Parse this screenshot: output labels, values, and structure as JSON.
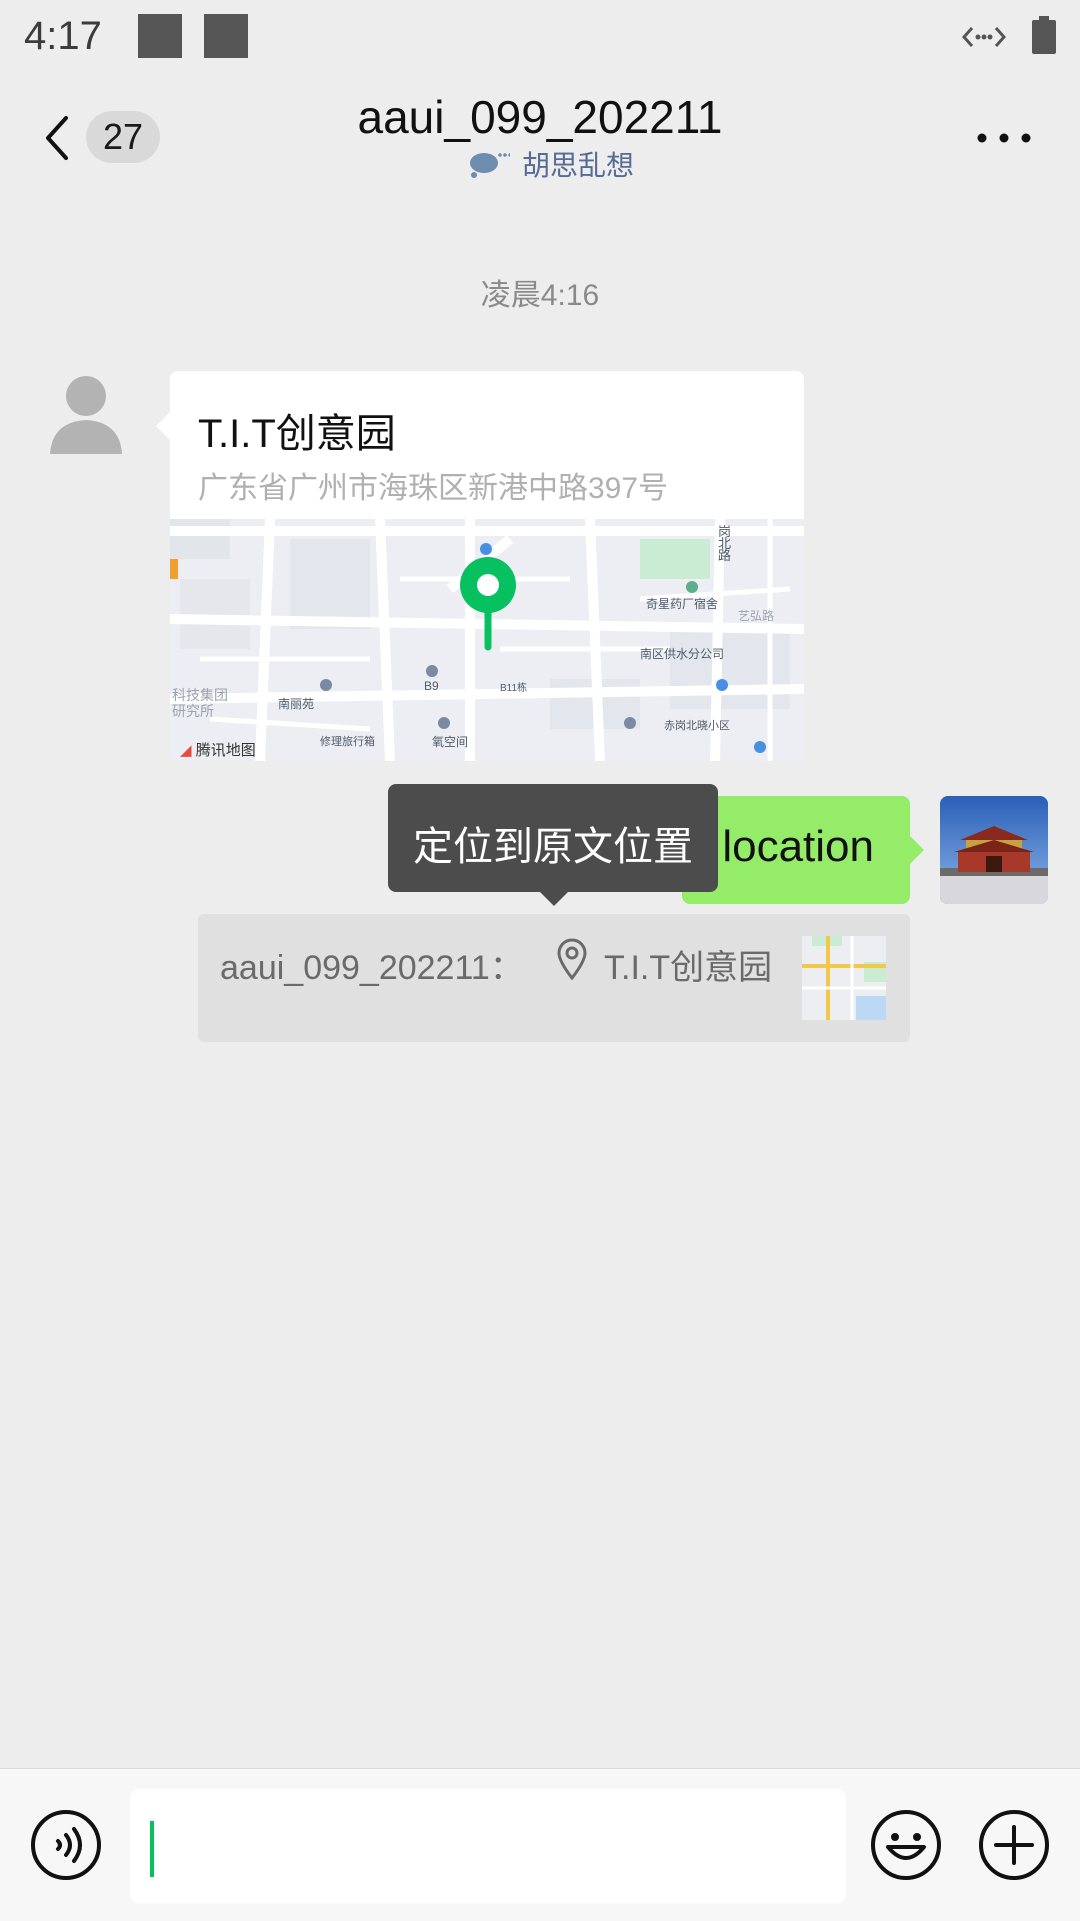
{
  "status_bar": {
    "time": "4:17"
  },
  "header": {
    "unread_count": "27",
    "title": "aaui_099_202211",
    "status_text": "胡思乱想"
  },
  "chat": {
    "timestamp": "凌晨4:16",
    "location_message": {
      "name": "T.I.T创意园",
      "address": "广东省广州市海珠区新港中路397号",
      "map_brand": "腾讯地图",
      "map_labels": [
        "奇星药厂宿舍",
        "艺弘路",
        "南区供水分公司",
        "B9",
        "B11栋",
        "南丽苑",
        "修理旅行箱",
        "氧空间",
        "赤岗北晓小区",
        "科技集团",
        "研究所",
        "岗",
        "北",
        "路"
      ]
    },
    "my_message": {
      "text": "location"
    },
    "tooltip": {
      "text": "定位到原文位置"
    },
    "quote": {
      "sender": "aaui_099_202211：",
      "content": "T.I.T创意园"
    }
  },
  "input": {
    "value": ""
  },
  "colors": {
    "accent": "#07c160",
    "bubble_green": "#95ec69",
    "link_blue": "#576b95"
  }
}
